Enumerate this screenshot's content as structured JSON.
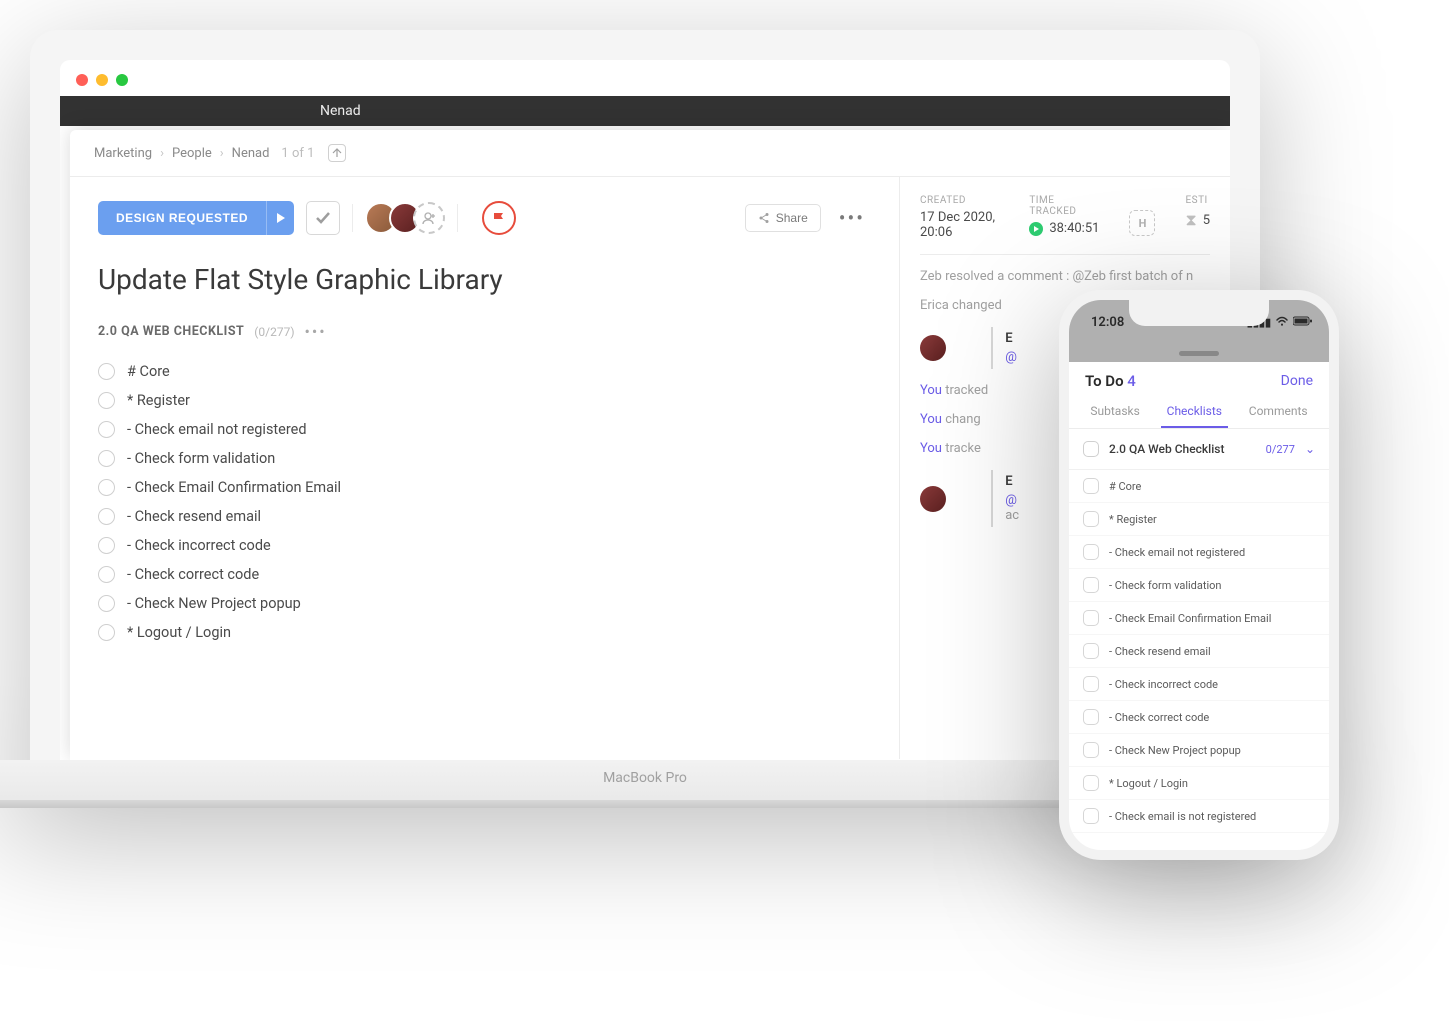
{
  "browser": {
    "tab_label": "Nenad"
  },
  "breadcrumbs": {
    "items": [
      "Marketing",
      "People",
      "Nenad"
    ],
    "position": "1 of 1"
  },
  "toolbar": {
    "status_label": "DESIGN REQUESTED",
    "share_label": "Share"
  },
  "task": {
    "title": "Update Flat Style Graphic Library"
  },
  "checklist": {
    "name": "2.0 QA WEB CHECKLIST",
    "count": "(0/277)",
    "items": [
      {
        "level": 0,
        "text": "# Core"
      },
      {
        "level": 1,
        "text": "* Register"
      },
      {
        "level": 2,
        "text": "- Check email not registered"
      },
      {
        "level": 2,
        "text": "- Check form validation"
      },
      {
        "level": 2,
        "text": "- Check Email Confirmation Email"
      },
      {
        "level": 2,
        "text": "- Check resend email"
      },
      {
        "level": 2,
        "text": "- Check incorrect code"
      },
      {
        "level": 2,
        "text": "- Check correct code"
      },
      {
        "level": 2,
        "text": "- Check New Project popup"
      },
      {
        "level": 1,
        "text": "* Logout / Login"
      }
    ]
  },
  "meta": {
    "created_label": "CREATED",
    "created_value": "17 Dec 2020, 20:06",
    "tracked_label": "TIME TRACKED",
    "tracked_value": "38:40:51",
    "h_badge": "H",
    "estimate_label": "ESTI",
    "estimate_value": "5"
  },
  "activity": {
    "items": [
      {
        "type": "comment",
        "text": "Zeb resolved a comment : @Zeb first batch of n"
      },
      {
        "type": "change",
        "text": "Erica changed"
      },
      {
        "type": "card_who",
        "who": "E",
        "snip": "@"
      },
      {
        "type": "you_tracked",
        "prefix": "You",
        "rest": " tracked"
      },
      {
        "type": "you_change",
        "prefix": "You",
        "rest": " chang"
      },
      {
        "type": "you_tracked2",
        "prefix": "You",
        "rest": " tracke"
      },
      {
        "type": "card_who2",
        "who": "E",
        "snip": "@",
        "snip2": "ac"
      }
    ]
  },
  "phone": {
    "clock": "12:08",
    "header_title": "To Do",
    "header_count": "4",
    "done_label": "Done",
    "tabs": [
      "Subtasks",
      "Checklists",
      "Comments"
    ],
    "list_header": {
      "name": "2.0 QA Web Checklist",
      "stat": "0/277"
    },
    "items": [
      {
        "level": 0,
        "text": "# Core"
      },
      {
        "level": 1,
        "text": "* Register"
      },
      {
        "level": 2,
        "text": "- Check email not registered"
      },
      {
        "level": 2,
        "text": "- Check form validation"
      },
      {
        "level": 2,
        "text": "- Check Email Confirmation Email"
      },
      {
        "level": 2,
        "text": "- Check resend email"
      },
      {
        "level": 2,
        "text": "- Check incorrect code"
      },
      {
        "level": 2,
        "text": "- Check correct code"
      },
      {
        "level": 2,
        "text": "- Check New Project popup"
      },
      {
        "level": 1,
        "text": "* Logout / Login"
      },
      {
        "level": 2,
        "text": "- Check email is not registered"
      }
    ]
  },
  "laptop": {
    "brand": "MacBook Pro"
  }
}
